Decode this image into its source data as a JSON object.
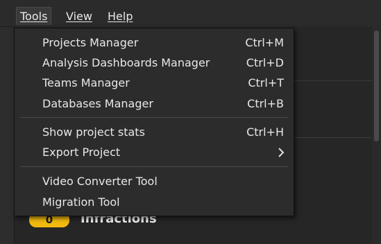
{
  "menubar": {
    "items": [
      {
        "label": "Tools"
      },
      {
        "label": "View"
      },
      {
        "label": "Help"
      }
    ]
  },
  "background": {
    "infractions_count": "0",
    "infractions_label": "Infractions"
  },
  "tools_menu": {
    "groups": [
      [
        {
          "label": "Projects Manager",
          "shortcut": "Ctrl+M"
        },
        {
          "label": "Analysis Dashboards Manager",
          "shortcut": "Ctrl+D"
        },
        {
          "label": "Teams Manager",
          "shortcut": "Ctrl+T"
        },
        {
          "label": "Databases Manager",
          "shortcut": "Ctrl+B"
        }
      ],
      [
        {
          "label": "Show project stats",
          "shortcut": "Ctrl+H"
        },
        {
          "label": "Export Project",
          "submenu_icon": "chevron-right-icon"
        }
      ],
      [
        {
          "label": "Video Converter Tool"
        },
        {
          "label": "Migration Tool"
        }
      ]
    ]
  },
  "colors": {
    "badge": "#f2b90f",
    "menu_bg": "#2c2c2c"
  }
}
